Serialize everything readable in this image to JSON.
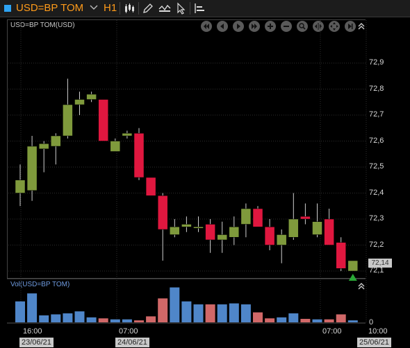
{
  "toolbar": {
    "symbol": "USD=BP TOM",
    "timeframe": "H1",
    "icons": [
      "chevron-down-icon",
      "candlestick-icon",
      "pencil-icon",
      "line-icon",
      "cursor-icon",
      "tools-icon"
    ]
  },
  "chart": {
    "title": "USD=BP TOM(USD)",
    "current_price": "72,14",
    "price_ticks": [
      "72,9",
      "72,8",
      "72,7",
      "72,6",
      "72,5",
      "72,4",
      "72,3",
      "72,2",
      "72,1"
    ]
  },
  "volume": {
    "title": "Vol(USD=BP TOM)",
    "zero_label": "0"
  },
  "time_axis": {
    "labels": [
      "16:00",
      "07:00",
      "07:00",
      "10:00"
    ],
    "dates": [
      "23/06/21",
      "24/06/21",
      "25/06/21"
    ]
  },
  "colors": {
    "up": "#7f9a3c",
    "down": "#e0173f",
    "vol_up": "#4f86c9",
    "vol_down": "#d16868",
    "accent": "#ff9b1a"
  },
  "chart_data": {
    "type": "candlestick",
    "ylim": [
      72.07,
      73.01
    ],
    "candles": [
      {
        "o": 72.4,
        "h": 72.51,
        "l": 72.35,
        "c": 72.45
      },
      {
        "o": 72.41,
        "h": 72.62,
        "l": 72.37,
        "c": 72.58
      },
      {
        "o": 72.57,
        "h": 72.6,
        "l": 72.48,
        "c": 72.59
      },
      {
        "o": 72.58,
        "h": 72.63,
        "l": 72.51,
        "c": 72.62
      },
      {
        "o": 72.62,
        "h": 72.84,
        "l": 72.61,
        "c": 72.74
      },
      {
        "o": 72.74,
        "h": 72.79,
        "l": 72.7,
        "c": 72.76
      },
      {
        "o": 72.76,
        "h": 72.79,
        "l": 72.75,
        "c": 72.78
      },
      {
        "o": 72.76,
        "h": 72.76,
        "l": 72.6,
        "c": 72.6
      },
      {
        "o": 72.56,
        "h": 72.61,
        "l": 72.56,
        "c": 72.6
      },
      {
        "o": 72.62,
        "h": 72.64,
        "l": 72.61,
        "c": 72.63
      },
      {
        "o": 72.63,
        "h": 72.65,
        "l": 72.45,
        "c": 72.46
      },
      {
        "o": 72.46,
        "h": 72.46,
        "l": 72.39,
        "c": 72.39
      },
      {
        "o": 72.39,
        "h": 72.4,
        "l": 72.14,
        "c": 72.26
      },
      {
        "o": 72.24,
        "h": 72.3,
        "l": 72.23,
        "c": 72.27
      },
      {
        "o": 72.27,
        "h": 72.31,
        "l": 72.25,
        "c": 72.28
      },
      {
        "o": 72.27,
        "h": 72.31,
        "l": 72.25,
        "c": 72.27
      },
      {
        "o": 72.28,
        "h": 72.3,
        "l": 72.17,
        "c": 72.22
      },
      {
        "o": 72.22,
        "h": 72.29,
        "l": 72.17,
        "c": 72.24
      },
      {
        "o": 72.23,
        "h": 72.31,
        "l": 72.2,
        "c": 72.27
      },
      {
        "o": 72.28,
        "h": 72.36,
        "l": 72.23,
        "c": 72.34
      },
      {
        "o": 72.34,
        "h": 72.35,
        "l": 72.27,
        "c": 72.27
      },
      {
        "o": 72.27,
        "h": 72.3,
        "l": 72.18,
        "c": 72.2
      },
      {
        "o": 72.2,
        "h": 72.26,
        "l": 72.13,
        "c": 72.24
      },
      {
        "o": 72.23,
        "h": 72.4,
        "l": 72.22,
        "c": 72.3
      },
      {
        "o": 72.31,
        "h": 72.36,
        "l": 72.28,
        "c": 72.3
      },
      {
        "o": 72.24,
        "h": 72.36,
        "l": 72.23,
        "c": 72.29
      },
      {
        "o": 72.3,
        "h": 72.34,
        "l": 72.2,
        "c": 72.2
      },
      {
        "o": 72.21,
        "h": 72.23,
        "l": 72.1,
        "c": 72.11
      },
      {
        "o": 72.1,
        "h": 72.14,
        "l": 72.1,
        "c": 72.14
      }
    ],
    "volumes": [
      0.42,
      0.58,
      0.14,
      0.16,
      0.18,
      0.22,
      0.1,
      0.08,
      0.06,
      0.06,
      0.04,
      0.12,
      0.48,
      0.7,
      0.42,
      0.36,
      0.36,
      0.36,
      0.38,
      0.36,
      0.2,
      0.08,
      0.1,
      0.18,
      0.07,
      0.06,
      0.06,
      0.16,
      0.04
    ]
  }
}
